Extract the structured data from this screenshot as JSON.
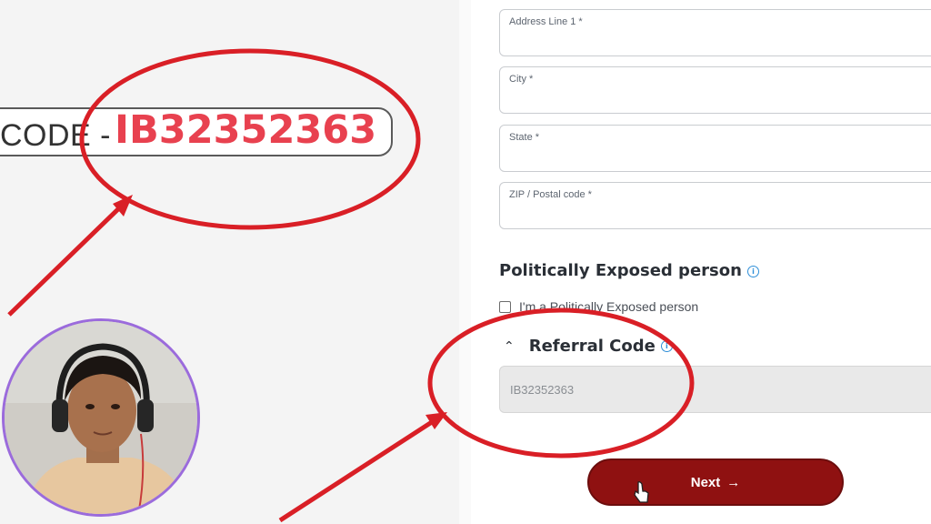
{
  "promo": {
    "code_prefix": "CODE -",
    "code_value": "IB32352363"
  },
  "form": {
    "fields": [
      {
        "label": "Address Line 1 *"
      },
      {
        "label": "City *"
      },
      {
        "label": "State *"
      },
      {
        "label": "ZIP / Postal code *"
      }
    ],
    "pep_section": {
      "title": "Politically Exposed person",
      "checkbox_label": "I'm a Politically Exposed person"
    },
    "referral": {
      "title": "Referral Code",
      "value": "IB32352363"
    },
    "next_label": "Next"
  },
  "colors": {
    "accent_red": "#e8414f",
    "annotation_red": "#d91f26",
    "button_bg": "#8f1111",
    "info_blue": "#2f8fd8"
  },
  "icons": [
    "info-icon",
    "chevron-up-icon",
    "arrow-right-icon",
    "pointer-cursor-icon"
  ]
}
